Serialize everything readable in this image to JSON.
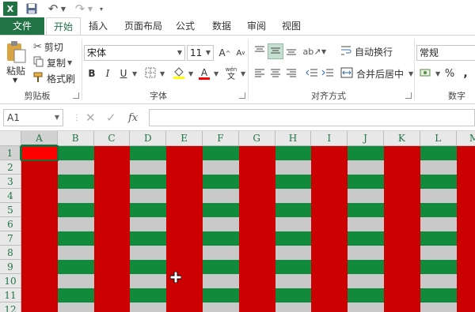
{
  "app": {
    "logo_text": "X"
  },
  "tabs": [
    "文件",
    "开始",
    "插入",
    "页面布局",
    "公式",
    "数据",
    "审阅",
    "视图"
  ],
  "clipboard": {
    "paste": "粘贴",
    "cut": "剪切",
    "copy": "复制",
    "format_painter": "格式刷",
    "group_label": "剪贴板"
  },
  "font": {
    "name": "宋体",
    "size": "11",
    "bold": "B",
    "italic": "I",
    "underline": "U",
    "grow": "A",
    "shrink": "A",
    "font_color": "A",
    "phonetic": "文",
    "group_label": "字体"
  },
  "alignment": {
    "wrap_text": "自动换行",
    "merge_center": "合并后居中",
    "group_label": "对齐方式"
  },
  "number": {
    "format": "常规",
    "percent": "%",
    "comma": ",",
    "group_label": "数字"
  },
  "formula_bar": {
    "name_box": "A1",
    "fx": "fx",
    "value": ""
  },
  "sheet": {
    "columns": [
      "A",
      "B",
      "C",
      "D",
      "E",
      "F",
      "G",
      "H",
      "I",
      "J",
      "K",
      "L",
      "M"
    ],
    "rows": [
      "1",
      "2",
      "3",
      "4",
      "5",
      "6",
      "7",
      "8",
      "9",
      "10",
      "11",
      "12"
    ],
    "colors": {
      "red": "#cc0000",
      "green": "#118a3c",
      "gray": "#c9c9c9",
      "bright_red": "#ff0000"
    },
    "selected_cell": "A1"
  }
}
